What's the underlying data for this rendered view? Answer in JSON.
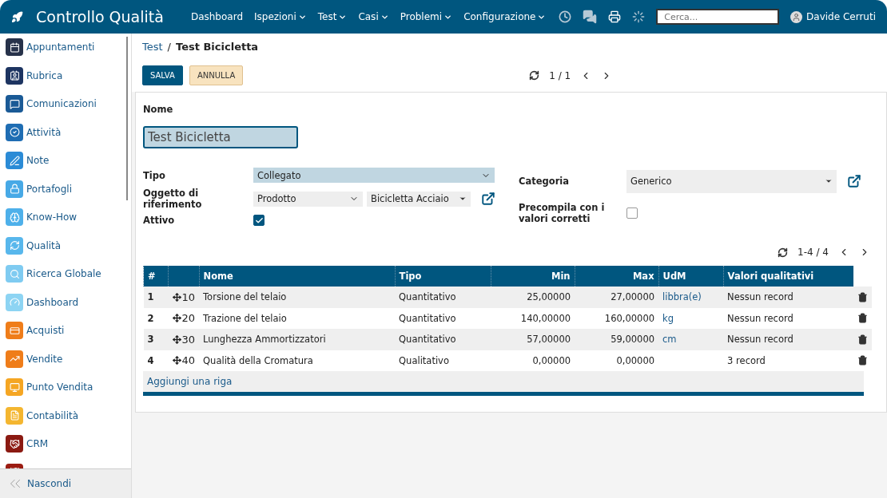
{
  "app": {
    "title": "Controllo Qualità"
  },
  "nav": [
    {
      "label": "Dashboard",
      "dropdown": false
    },
    {
      "label": "Ispezioni",
      "dropdown": true
    },
    {
      "label": "Test",
      "dropdown": true
    },
    {
      "label": "Casi",
      "dropdown": true
    },
    {
      "label": "Problemi",
      "dropdown": true
    },
    {
      "label": "Configurazione",
      "dropdown": true
    }
  ],
  "search": {
    "placeholder": "Cerca..."
  },
  "user": {
    "name": "Davide Cerruti"
  },
  "sidebar": {
    "items": [
      {
        "label": "Appuntamenti",
        "color": "#27324a"
      },
      {
        "label": "Rubrica",
        "color": "#1d3461"
      },
      {
        "label": "Comunicazioni",
        "color": "#1a5a96"
      },
      {
        "label": "Attività",
        "color": "#1f6db3"
      },
      {
        "label": "Note",
        "color": "#2b8bd6"
      },
      {
        "label": "Portafogli",
        "color": "#47a9e6"
      },
      {
        "label": "Know-How",
        "color": "#4eb0ea"
      },
      {
        "label": "Qualità",
        "color": "#58b7ec"
      },
      {
        "label": "Ricerca Globale",
        "color": "#7fcbf1"
      },
      {
        "label": "Dashboard",
        "color": "#8dd4f3"
      },
      {
        "label": "Acquisti",
        "color": "#ef7d1a"
      },
      {
        "label": "Vendite",
        "color": "#ef7d1a"
      },
      {
        "label": "Punto Vendita",
        "color": "#f5a623"
      },
      {
        "label": "Contabilità",
        "color": "#f4b630"
      },
      {
        "label": "CRM",
        "color": "#8b1a12"
      },
      {
        "color": "#9b1c12"
      }
    ],
    "hide": "Nascondi"
  },
  "breadcrumb": {
    "parent": "Test",
    "separator": "/",
    "current": "Test Bicicletta"
  },
  "buttons": {
    "save": "SALVA",
    "cancel": "ANNULLA"
  },
  "pager": {
    "text": "1 / 1"
  },
  "form": {
    "name_label": "Nome",
    "name_value": "Test Bicicletta",
    "tipo_label": "Tipo",
    "tipo_value": "Collegato",
    "oggetto_label": "Oggetto di riferimento",
    "oggetto_model": "Prodotto",
    "oggetto_record": "Bicicletta Acciaio",
    "attivo_label": "Attivo",
    "attivo_checked": true,
    "categoria_label": "Categoria",
    "categoria_value": "Generico",
    "precompila_label": "Precompila con i valori corretti",
    "precompila_checked": false
  },
  "table": {
    "pager": "1-4 / 4",
    "columns": [
      "#",
      "Nome",
      "Tipo",
      "Min",
      "Max",
      "UdM",
      "Valori qualitativi"
    ],
    "rows": [
      {
        "num": "1",
        "seq": "10",
        "nome": "Torsione del telaio",
        "tipo": "Quantitativo",
        "min": "25,00000",
        "max": "27,00000",
        "udm": "libbra(e)",
        "valori": "Nessun record"
      },
      {
        "num": "2",
        "seq": "20",
        "nome": "Trazione del telaio",
        "tipo": "Quantitativo",
        "min": "140,00000",
        "max": "160,00000",
        "udm": "kg",
        "valori": "Nessun record"
      },
      {
        "num": "3",
        "seq": "30",
        "nome": "Lunghezza Ammortizzatori",
        "tipo": "Quantitativo",
        "min": "57,00000",
        "max": "59,00000",
        "udm": "cm",
        "valori": "Nessun record"
      },
      {
        "num": "4",
        "seq": "40",
        "nome": "Qualità della Cromatura",
        "tipo": "Qualitativo",
        "min": "0,00000",
        "max": "0,00000",
        "valori": "3 record"
      }
    ],
    "add": "Aggiungi una riga"
  }
}
